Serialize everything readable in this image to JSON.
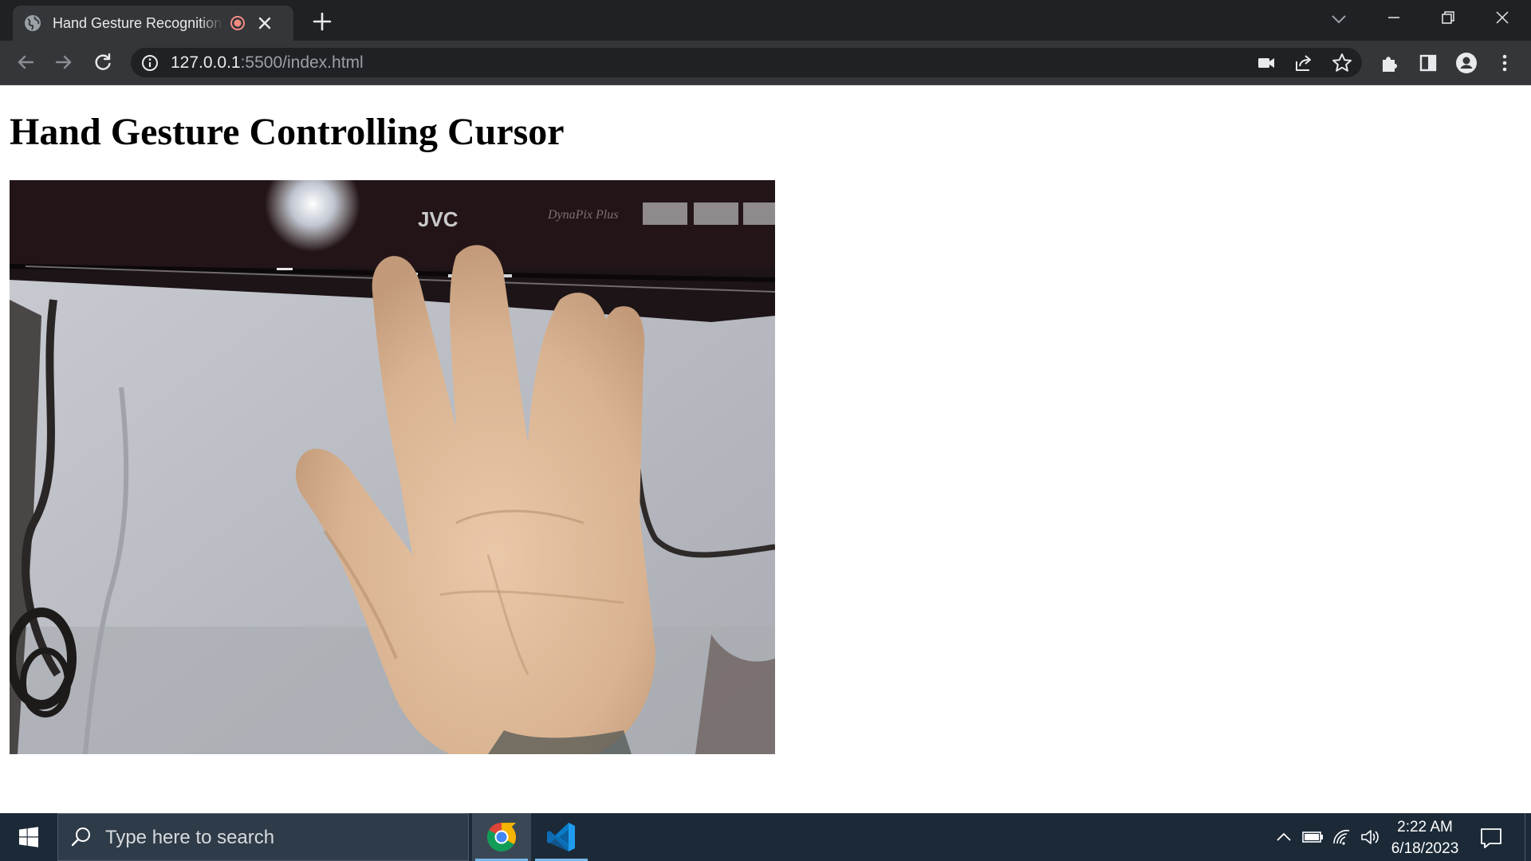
{
  "browser": {
    "tab": {
      "title": "Hand Gesture Recognition Controlling Cursor",
      "favicon": "globe-icon",
      "recording_indicator": "recording-dot-icon",
      "close_icon": "close-icon"
    },
    "new_tab_icon": "plus-icon",
    "tab_search_icon": "chevron-down-icon",
    "window_controls": [
      "minimize-icon",
      "restore-icon",
      "close-icon"
    ],
    "nav": [
      "back-arrow-icon",
      "forward-arrow-icon",
      "reload-icon"
    ],
    "address_bar": {
      "site_info_icon": "info-icon",
      "url_host": "127.0.0.1",
      "url_rest": ":5500/index.html",
      "icons": [
        "camera-icon",
        "share-icon",
        "star-icon"
      ]
    },
    "toolbar_icons": [
      "extensions-puzzle-icon",
      "side-panel-icon",
      "profile-avatar-icon",
      "kebab-menu-icon"
    ],
    "colors": {
      "frame": "#202124",
      "toolbar": "#35363a",
      "text": "#e8eaed",
      "muted": "#9aa0a6"
    }
  },
  "page": {
    "title": "Hand Gesture Controlling Cursor",
    "video": {
      "description_label": "webcam-video-feed",
      "monitor_brand": "JVC",
      "monitor_model": "DynaPix Plus"
    }
  },
  "taskbar": {
    "start_icon": "windows-logo-icon",
    "search_placeholder": "Type here to search",
    "apps": [
      {
        "name": "Google Chrome",
        "icon": "chrome-icon",
        "active": true
      },
      {
        "name": "Visual Studio Code",
        "icon": "vscode-icon",
        "active": false
      }
    ],
    "tray": [
      "chevron-up-icon",
      "battery-icon",
      "wifi-icon",
      "volume-icon"
    ],
    "time": "2:22 AM",
    "date": "6/18/2023",
    "notification_icon": "action-center-icon",
    "colors": {
      "bar": "#1c2a38",
      "accent": "#76b9ed"
    }
  }
}
